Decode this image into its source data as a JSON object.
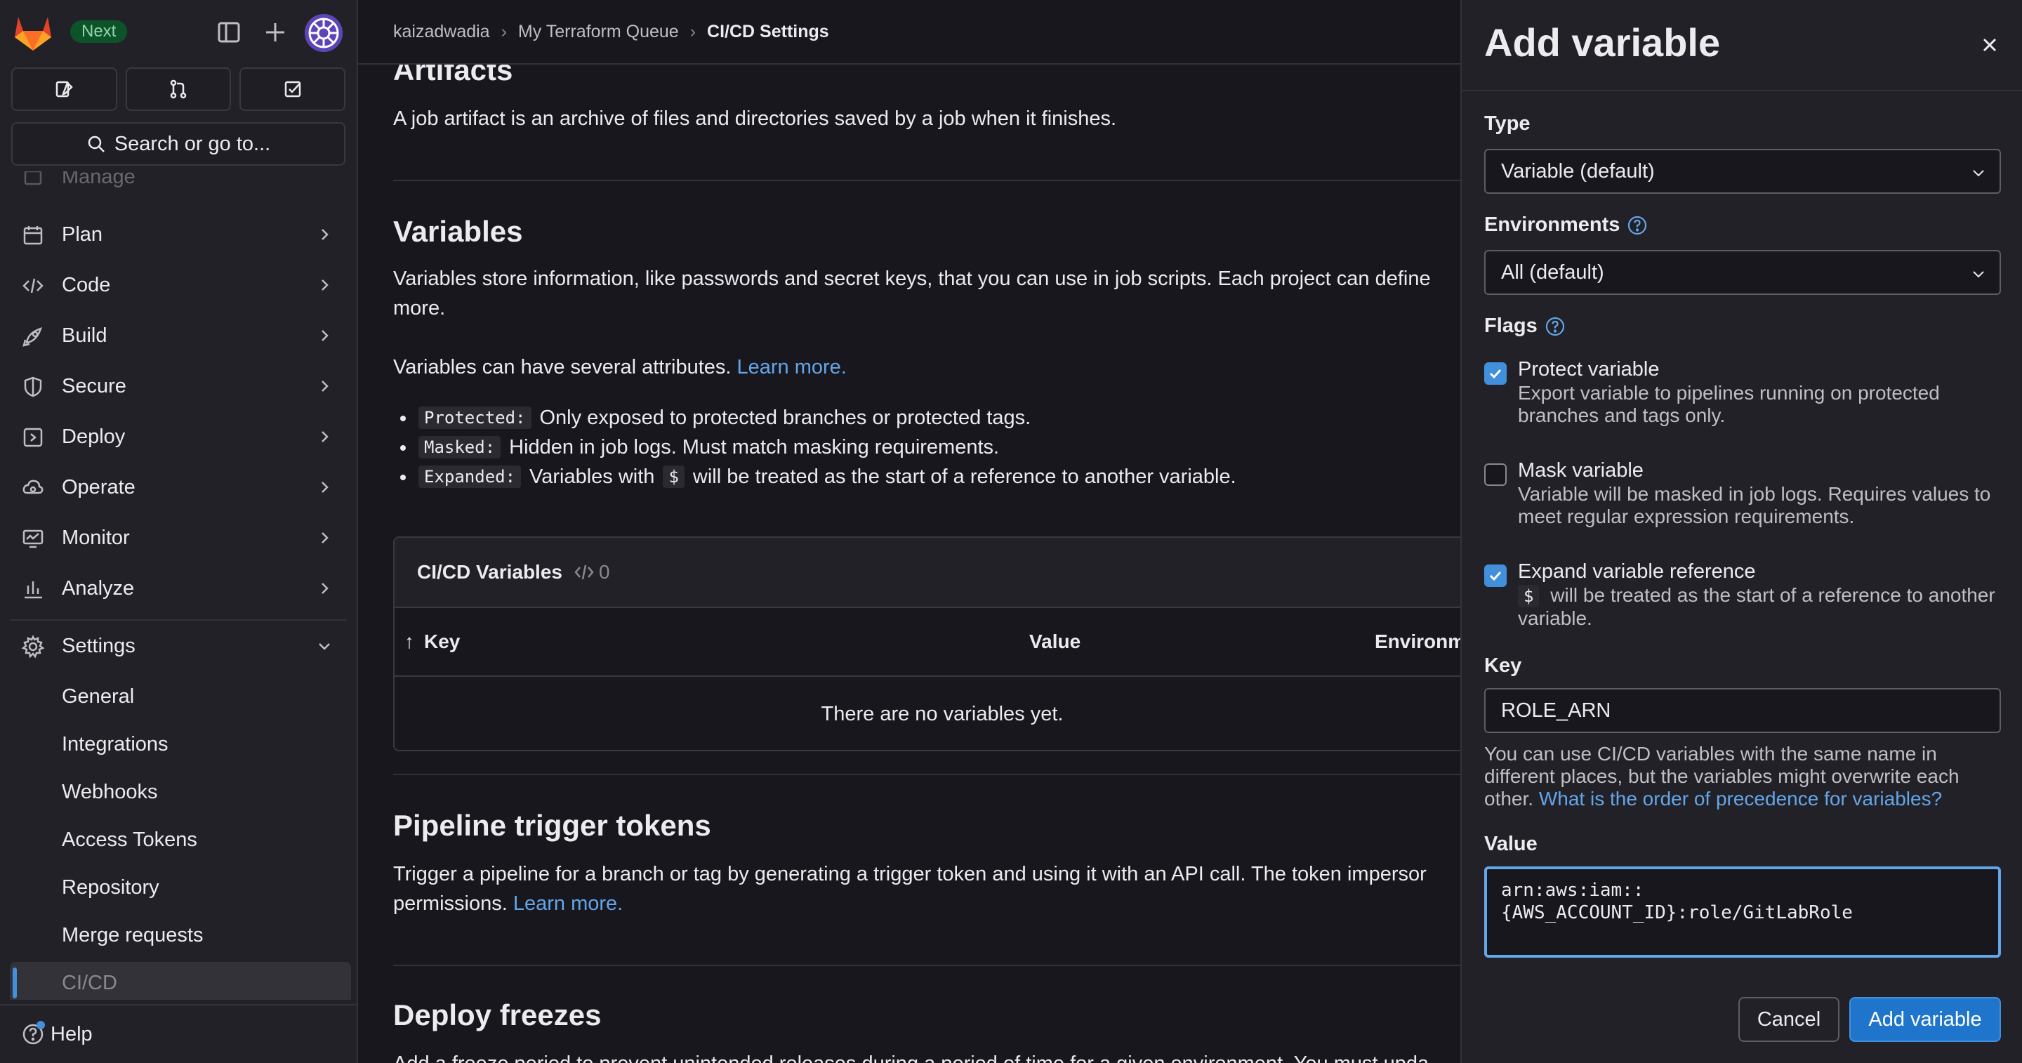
{
  "sidebar": {
    "badge": "Next",
    "search_label": "Search or go to...",
    "faded_item": "Manage",
    "nav_items": [
      {
        "label": "Plan"
      },
      {
        "label": "Code"
      },
      {
        "label": "Build"
      },
      {
        "label": "Secure"
      },
      {
        "label": "Deploy"
      },
      {
        "label": "Operate"
      },
      {
        "label": "Monitor"
      },
      {
        "label": "Analyze"
      }
    ],
    "settings_label": "Settings",
    "settings_sub": [
      {
        "label": "General"
      },
      {
        "label": "Integrations"
      },
      {
        "label": "Webhooks"
      },
      {
        "label": "Access Tokens"
      },
      {
        "label": "Repository"
      },
      {
        "label": "Merge requests"
      },
      {
        "label": "CI/CD"
      }
    ],
    "help_label": "Help"
  },
  "breadcrumb": {
    "items": [
      "kaizadwadia",
      "My Terraform Queue",
      "CI/CD Settings"
    ]
  },
  "main": {
    "artifacts": {
      "title": "Artifacts",
      "desc": "A job artifact is an archive of files and directories saved by a job when it finishes."
    },
    "variables": {
      "title": "Variables",
      "desc": "Variables store information, like passwords and secret keys, that you can use in job scripts. Each project can define",
      "desc_link": "more.",
      "attrs_text": "Variables can have several attributes.",
      "attrs_link": "Learn more.",
      "bullets": [
        {
          "code": "Protected:",
          "text": "Only exposed to protected branches or protected tags."
        },
        {
          "code": "Masked:",
          "text": "Hidden in job logs. Must match masking requirements."
        },
        {
          "code": "Expanded:",
          "text_before": "Variables with",
          "inline_code": "$",
          "text_after": "will be treated as the start of a reference to another variable."
        }
      ],
      "card_title": "CI/CD Variables",
      "card_count": "0",
      "columns": [
        "Key",
        "Value",
        "Environment"
      ],
      "empty": "There are no variables yet."
    },
    "pipeline": {
      "title": "Pipeline trigger tokens",
      "desc": "Trigger a pipeline for a branch or tag by generating a trigger token and using it with an API call. The token impersor",
      "desc2": "permissions.",
      "link": "Learn more."
    },
    "deploy": {
      "title": "Deploy freezes",
      "desc": "Add a freeze period to prevent unintended releases during a period of time for a given environment. You must upda"
    }
  },
  "drawer": {
    "title": "Add variable",
    "type_label": "Type",
    "type_value": "Variable (default)",
    "env_label": "Environments",
    "env_value": "All (default)",
    "flags_label": "Flags",
    "flags": [
      {
        "title": "Protect variable",
        "desc": "Export variable to pipelines running on protected branches and tags only.",
        "checked": true
      },
      {
        "title": "Mask variable",
        "desc": "Variable will be masked in job logs. Requires values to meet regular expression requirements.",
        "checked": false
      },
      {
        "title": "Expand variable reference",
        "code": "$",
        "desc": "will be treated as the start of a reference to another variable.",
        "checked": true
      }
    ],
    "key_label": "Key",
    "key_value": "ROLE_ARN",
    "key_help": "You can use CI/CD variables with the same name in different places, but the variables might overwrite each other.",
    "key_help_link": "What is the order of precedence for variables?",
    "value_label": "Value",
    "value_line1": "arn:aws:iam::",
    "value_line2": "{AWS_ACCOUNT_ID}:role/GitLabRole",
    "cancel_label": "Cancel",
    "submit_label": "Add variable"
  },
  "colors": {
    "accent": "#1f75cb",
    "link": "#63a6e9",
    "badge_bg": "#0d532a"
  },
  "icons": [
    "gitlab-logo",
    "sidebar-toggle-icon",
    "plus-icon",
    "avatar",
    "issues-icon",
    "merge-request-icon",
    "todo-icon",
    "search-icon",
    "close-icon",
    "question-icon",
    "chevron-down-icon"
  ]
}
